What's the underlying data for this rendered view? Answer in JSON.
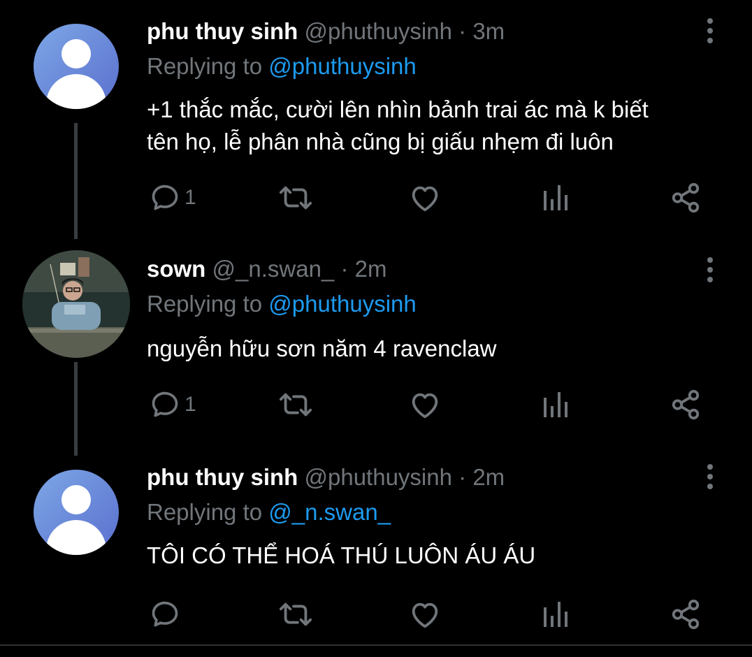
{
  "tweets": [
    {
      "display_name": "phu thuy sinh",
      "handle": "@phuthuysinh",
      "separator": "·",
      "time": "3m",
      "replying_prefix": "Replying to ",
      "replying_to": "@phuthuysinh",
      "lines": [
        "+1 thắc mắc, cười lên nhìn bảnh trai ác mà k biết",
        "tên họ, lễ phân nhà cũng bị giấu nhẹm đi luôn"
      ],
      "reply_count": "1",
      "avatar": "default-avatar"
    },
    {
      "display_name": "sown",
      "handle": "@_n.swan_",
      "separator": "·",
      "time": "2m",
      "replying_prefix": "Replying to ",
      "replying_to": "@phuthuysinh",
      "lines": [
        "nguyễn hữu sơn năm 4 ravenclaw"
      ],
      "reply_count": "1",
      "avatar": "photo-avatar"
    },
    {
      "display_name": "phu thuy sinh",
      "handle": "@phuthuysinh",
      "separator": "·",
      "time": "2m",
      "replying_prefix": "Replying to ",
      "replying_to": "@_n.swan_",
      "lines": [
        "TÔI CÓ THỂ HOÁ THÚ LUÔN ÁU ÁU"
      ],
      "reply_count": "",
      "avatar": "default-avatar"
    }
  ],
  "icons": {
    "reply": "reply-icon",
    "retweet": "retweet-icon",
    "like": "like-icon",
    "views": "views-icon",
    "share": "share-icon",
    "more": "more-options-icon"
  },
  "colors": {
    "background": "#000000",
    "text": "#ffffff",
    "muted": "#71767b",
    "link": "#1d9bf0",
    "thread_line": "#3a3d40",
    "avatar_gradient_start": "#7da7e6",
    "avatar_gradient_end": "#5a6fce"
  }
}
